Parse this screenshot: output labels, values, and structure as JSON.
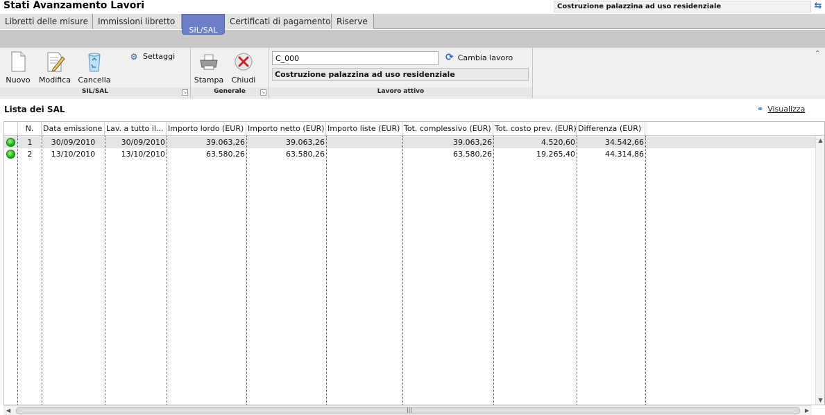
{
  "app": {
    "title": "Stati Avanzamento Lavori",
    "project_name": "Costruzione palazzina ad uso residenziale",
    "swap_icon": "swap-icon"
  },
  "tabs": [
    {
      "label": "Libretti delle misure"
    },
    {
      "label": "Immissioni libretto"
    },
    {
      "label": "SIL/SAL",
      "active": true
    },
    {
      "label": "Certificati di pagamento"
    },
    {
      "label": "Riserve"
    }
  ],
  "ribbon": {
    "sil_sal": {
      "label": "SIL/SAL",
      "nuovo": "Nuovo",
      "modifica": "Modifica",
      "cancella": "Cancella",
      "settaggi": "Settaggi"
    },
    "generale": {
      "label": "Generale",
      "stampa": "Stampa",
      "chiudi": "Chiudi"
    },
    "lavoro_attivo": {
      "label": "Lavoro attivo",
      "code": "C_000",
      "cambia": "Cambia lavoro",
      "project": "Costruzione palazzina ad uso residenziale"
    }
  },
  "list": {
    "title": "Lista dei SAL",
    "visualizza": "Visualizza",
    "columns": [
      "N.",
      "Data emissione",
      "Lav. a tutto il...",
      "Importo lordo (EUR)",
      "Importo netto (EUR)",
      "Importo liste (EUR)",
      "Tot. complessivo (EUR)",
      "Tot. costo prev. (EUR)",
      "Differenza (EUR)"
    ],
    "rows": [
      {
        "status": "green",
        "n": "1",
        "data": "30/09/2010",
        "lav": "30/09/2010",
        "lordo": "39.063,26",
        "netto": "39.063,26",
        "liste": "",
        "tot": "39.063,26",
        "costo": "4.520,60",
        "diff": "34.542,66"
      },
      {
        "status": "green",
        "n": "2",
        "data": "13/10/2010",
        "lav": "13/10/2010",
        "lordo": "63.580,26",
        "netto": "63.580,26",
        "liste": "",
        "tot": "63.580,26",
        "costo": "19.265,40",
        "diff": "44.314,86"
      }
    ]
  },
  "colors": {
    "accent": "#6d7fc8",
    "status_ok": "#22b21c"
  }
}
